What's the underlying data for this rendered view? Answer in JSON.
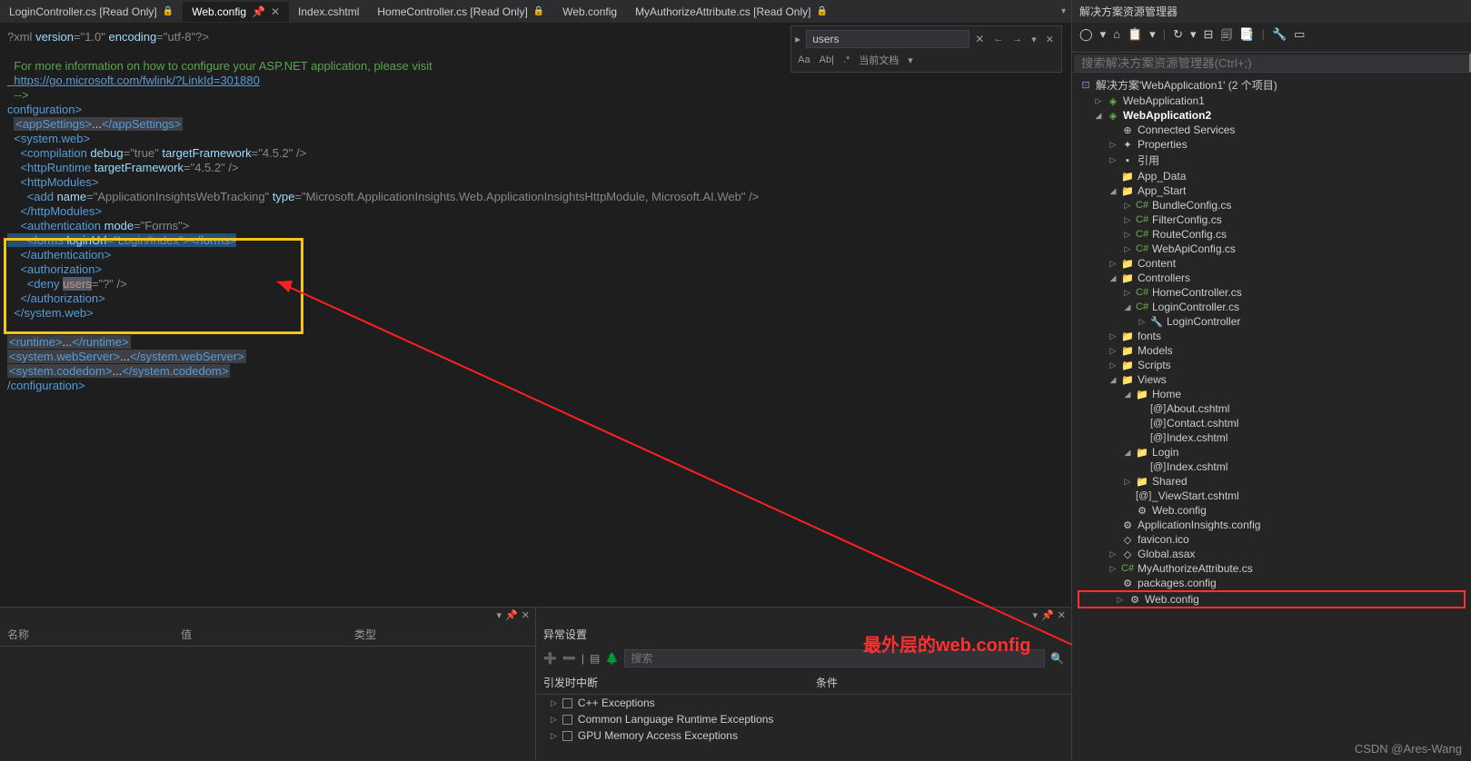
{
  "tabs": [
    {
      "label": "LoginController.cs [Read Only]",
      "active": false,
      "lock": true
    },
    {
      "label": "Web.config",
      "active": true,
      "lock": false
    },
    {
      "label": "Index.cshtml",
      "active": false,
      "lock": false
    },
    {
      "label": "HomeController.cs [Read Only]",
      "active": false,
      "lock": true
    },
    {
      "label": "Web.config",
      "active": false,
      "lock": false
    },
    {
      "label": "MyAuthorizeAttribute.cs [Read Only]",
      "active": false,
      "lock": true
    }
  ],
  "search": {
    "value": "users",
    "scope": "当前文档",
    "aa": "Aa",
    "ab": "Ab|",
    "re": ".*"
  },
  "code": {
    "l1_a": "?xml ",
    "l1_b": "version",
    "l1_c": "=\"1.0\" ",
    "l1_d": "encoding",
    "l1_e": "=\"utf-8\"?>",
    "l3": "  For more information on how to configure your ASP.NET application, please visit",
    "l4": "  https://go.microsoft.com/fwlink/?LinkId=301880",
    "l5": "  -->",
    "l6": "configuration>",
    "l7a": "<appSettings>",
    "l7b": "...",
    "l7c": "</appSettings>",
    "l8": "  <system.web>",
    "l9a": "    <compilation ",
    "l9b": "debug",
    "l9c": "=\"true\" ",
    "l9d": "targetFramework",
    "l9e": "=\"4.5.2\" />",
    "l10a": "    <httpRuntime ",
    "l10b": "targetFramework",
    "l10c": "=\"4.5.2\" />",
    "l11": "    <httpModules>",
    "l12a": "      <add ",
    "l12b": "name",
    "l12c": "=\"ApplicationInsightsWebTracking\" ",
    "l12d": "type",
    "l12e": "=\"Microsoft.ApplicationInsights.Web.ApplicationInsightsHttpModule, Microsoft.AI.Web\" />",
    "l13": "    </httpModules>",
    "l14a": "    <authentication ",
    "l14b": "mode",
    "l14c": "=\"Forms\">",
    "l15a": "      <forms ",
    "l15b": "loginUrl",
    "l15c": "=\"Login/Index\">",
    "l15d": "</forms>",
    "l16": "    </authentication>",
    "l17": "    <authorization>",
    "l18a": "      <deny ",
    "l18b": "users",
    "l18c": "=\"?\" />",
    "l19": "    </authorization>",
    "l20": "  </system.web>",
    "l22a": "<runtime>",
    "l22b": "...",
    "l22c": "</runtime>",
    "l23a": "<system.webServer>",
    "l23b": "...",
    "l23c": "</system.webServer>",
    "l24a": "<system.codedom>",
    "l24b": "...",
    "l24c": "</system.codedom>",
    "l25": "/configuration>"
  },
  "panel1": {
    "col1": "名称",
    "col2": "值",
    "col3": "类型"
  },
  "panel2": {
    "title": "异常设置",
    "searchPh": "搜索",
    "col1": "引发时中断",
    "col2": "条件",
    "rows": [
      {
        "label": "C++ Exceptions"
      },
      {
        "label": "Common Language Runtime Exceptions"
      },
      {
        "label": "GPU Memory Access Exceptions"
      }
    ]
  },
  "annotation": "最外层的web.config",
  "sidebar": {
    "title": "解决方案资源管理器",
    "searchPh": "搜索解决方案资源管理器(Ctrl+;)",
    "sln": "解决方案'WebApplication1' (2 个项目)",
    "items": [
      {
        "l": 1,
        "arr": "▷",
        "ico": "◈",
        "cls": "ico-proj",
        "lbl": "WebApplication1"
      },
      {
        "l": 1,
        "arr": "◢",
        "ico": "◈",
        "cls": "ico-proj",
        "lbl": "WebApplication2",
        "bold": true
      },
      {
        "l": 2,
        "arr": "",
        "ico": "⊕",
        "cls": "ico-file",
        "lbl": "Connected Services"
      },
      {
        "l": 2,
        "arr": "▷",
        "ico": "✦",
        "cls": "ico-file",
        "lbl": "Properties"
      },
      {
        "l": 2,
        "arr": "▷",
        "ico": "▪",
        "cls": "ico-file",
        "lbl": "引用"
      },
      {
        "l": 2,
        "arr": "",
        "ico": "📁",
        "cls": "ico-folder",
        "lbl": "App_Data"
      },
      {
        "l": 2,
        "arr": "◢",
        "ico": "📁",
        "cls": "ico-folder",
        "lbl": "App_Start"
      },
      {
        "l": 3,
        "arr": "▷",
        "ico": "C#",
        "cls": "ico-cs",
        "lbl": "BundleConfig.cs"
      },
      {
        "l": 3,
        "arr": "▷",
        "ico": "C#",
        "cls": "ico-cs",
        "lbl": "FilterConfig.cs"
      },
      {
        "l": 3,
        "arr": "▷",
        "ico": "C#",
        "cls": "ico-cs",
        "lbl": "RouteConfig.cs"
      },
      {
        "l": 3,
        "arr": "▷",
        "ico": "C#",
        "cls": "ico-cs",
        "lbl": "WebApiConfig.cs"
      },
      {
        "l": 2,
        "arr": "▷",
        "ico": "📁",
        "cls": "ico-folder",
        "lbl": "Content"
      },
      {
        "l": 2,
        "arr": "◢",
        "ico": "📁",
        "cls": "ico-folder",
        "lbl": "Controllers"
      },
      {
        "l": 3,
        "arr": "▷",
        "ico": "C#",
        "cls": "ico-cs",
        "lbl": "HomeController.cs"
      },
      {
        "l": 3,
        "arr": "◢",
        "ico": "C#",
        "cls": "ico-cs",
        "lbl": "LoginController.cs"
      },
      {
        "l": 4,
        "arr": "▷",
        "ico": "🔧",
        "cls": "ico-file",
        "lbl": "LoginController"
      },
      {
        "l": 2,
        "arr": "▷",
        "ico": "📁",
        "cls": "ico-folder",
        "lbl": "fonts"
      },
      {
        "l": 2,
        "arr": "▷",
        "ico": "📁",
        "cls": "ico-folder",
        "lbl": "Models"
      },
      {
        "l": 2,
        "arr": "▷",
        "ico": "📁",
        "cls": "ico-folder",
        "lbl": "Scripts"
      },
      {
        "l": 2,
        "arr": "◢",
        "ico": "📁",
        "cls": "ico-folder",
        "lbl": "Views"
      },
      {
        "l": 3,
        "arr": "◢",
        "ico": "📁",
        "cls": "ico-folder",
        "lbl": "Home"
      },
      {
        "l": 4,
        "arr": "",
        "ico": "[@]",
        "cls": "ico-file",
        "lbl": "About.cshtml"
      },
      {
        "l": 4,
        "arr": "",
        "ico": "[@]",
        "cls": "ico-file",
        "lbl": "Contact.cshtml"
      },
      {
        "l": 4,
        "arr": "",
        "ico": "[@]",
        "cls": "ico-file",
        "lbl": "Index.cshtml"
      },
      {
        "l": 3,
        "arr": "◢",
        "ico": "📁",
        "cls": "ico-folder",
        "lbl": "Login"
      },
      {
        "l": 4,
        "arr": "",
        "ico": "[@]",
        "cls": "ico-file",
        "lbl": "Index.cshtml"
      },
      {
        "l": 3,
        "arr": "▷",
        "ico": "📁",
        "cls": "ico-folder",
        "lbl": "Shared"
      },
      {
        "l": 3,
        "arr": "",
        "ico": "[@]",
        "cls": "ico-file",
        "lbl": "_ViewStart.cshtml"
      },
      {
        "l": 3,
        "arr": "",
        "ico": "⚙",
        "cls": "ico-cfg",
        "lbl": "Web.config"
      },
      {
        "l": 2,
        "arr": "",
        "ico": "⚙",
        "cls": "ico-cfg",
        "lbl": "ApplicationInsights.config"
      },
      {
        "l": 2,
        "arr": "",
        "ico": "◇",
        "cls": "ico-file",
        "lbl": "favicon.ico"
      },
      {
        "l": 2,
        "arr": "▷",
        "ico": "◇",
        "cls": "ico-file",
        "lbl": "Global.asax"
      },
      {
        "l": 2,
        "arr": "▷",
        "ico": "C#",
        "cls": "ico-cs",
        "lbl": "MyAuthorizeAttribute.cs"
      },
      {
        "l": 2,
        "arr": "",
        "ico": "⚙",
        "cls": "ico-cfg",
        "lbl": "packages.config"
      },
      {
        "l": 2,
        "arr": "▷",
        "ico": "⚙",
        "cls": "ico-cfg",
        "lbl": "Web.config",
        "redbox": true
      }
    ]
  },
  "watermark": "CSDN @Ares-Wang"
}
